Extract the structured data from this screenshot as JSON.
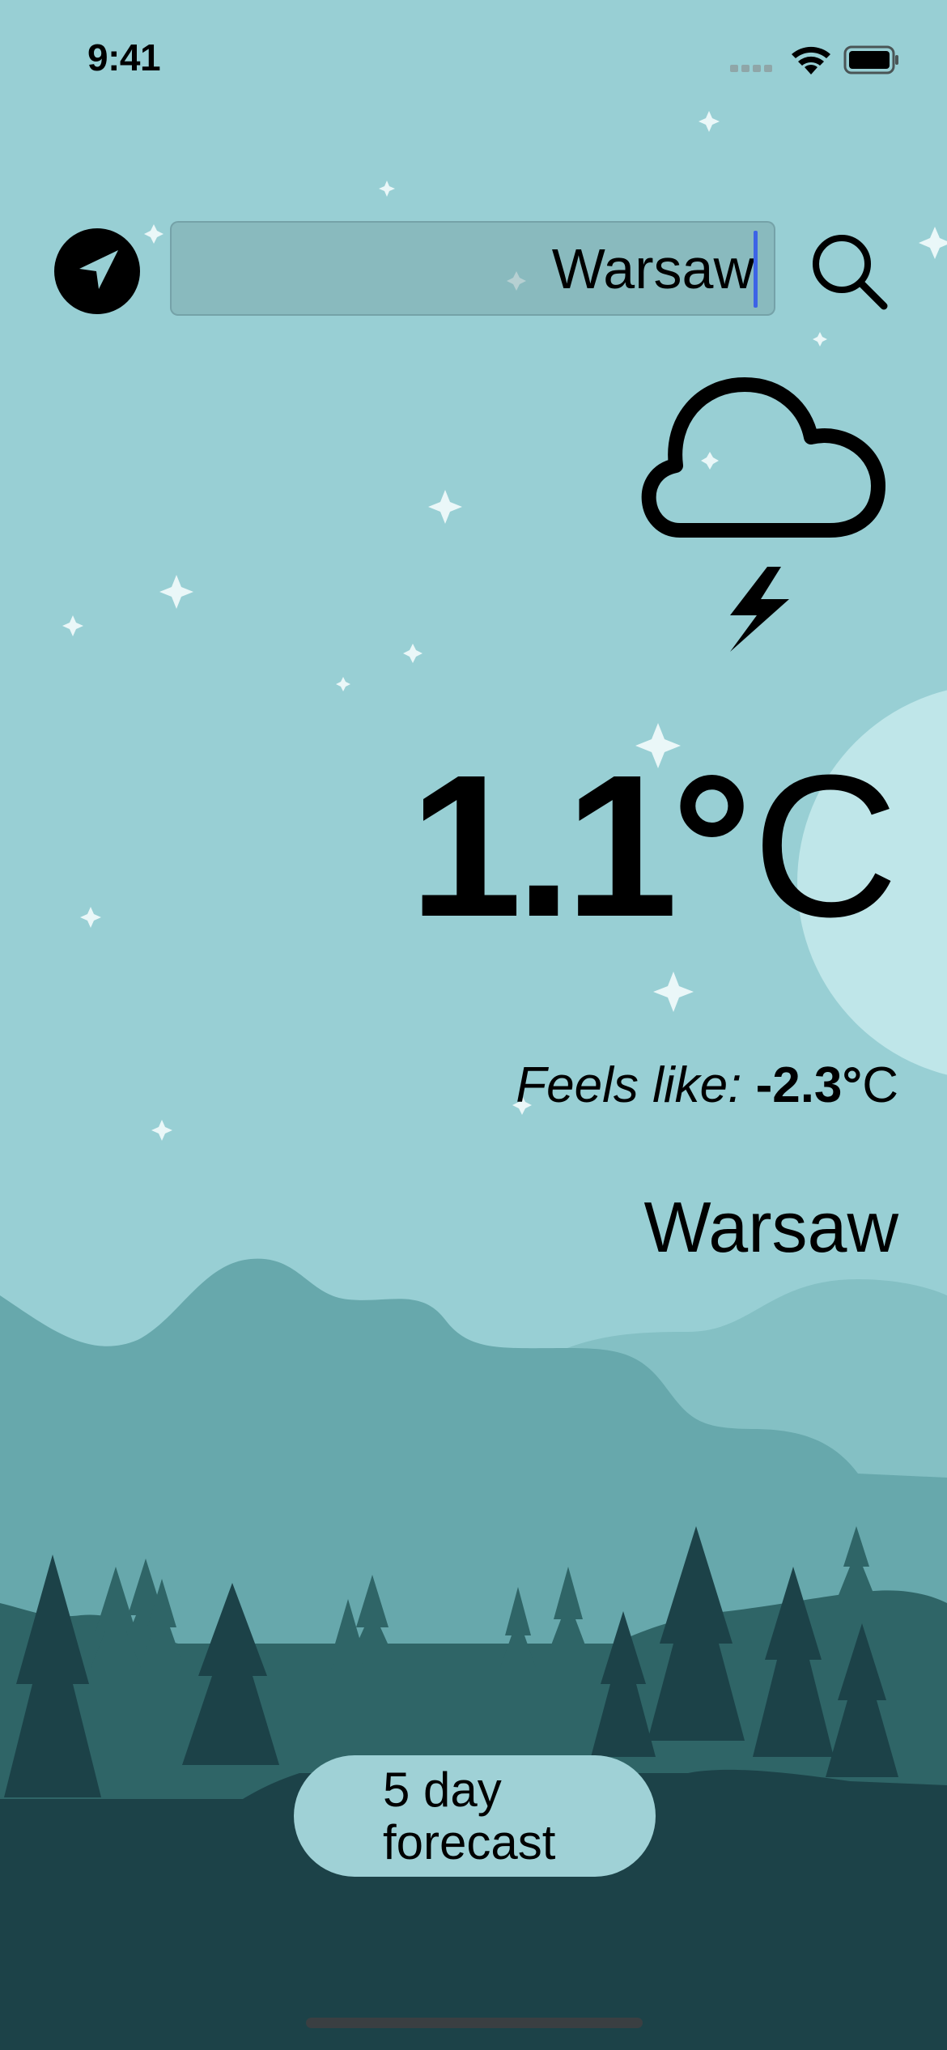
{
  "status_bar": {
    "time": "9:41"
  },
  "search": {
    "value": "Warsaw"
  },
  "weather": {
    "temperature": "1.1",
    "degree_symbol": "°",
    "unit": "C",
    "feels_like_label": "Feels like:",
    "feels_like_value": "-2.3",
    "city": "Warsaw",
    "condition_icon": "cloud-lightning-icon"
  },
  "forecast_button": {
    "label_line1": "5 day",
    "label_line2": "forecast"
  },
  "colors": {
    "sky": "#98cfd4",
    "hill_far": "#84c0c4",
    "hill_mid": "#67a8ac",
    "hill_near": "#2f6567",
    "forest": "#1c4248",
    "moon": "#bfe6e9",
    "button": "#9fd1d6",
    "caret": "#3d63e6"
  }
}
